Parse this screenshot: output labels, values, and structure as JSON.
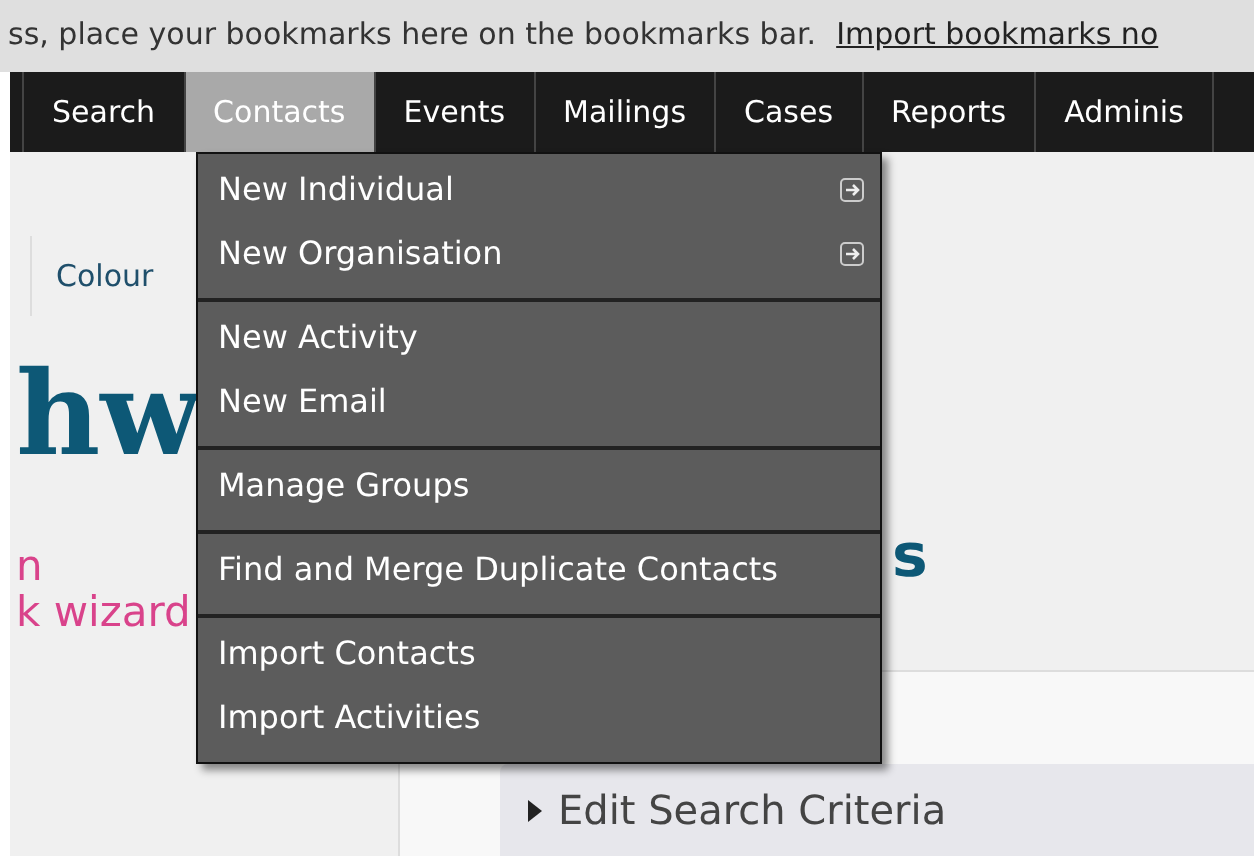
{
  "bookmarks_bar": {
    "message": "ss, place your bookmarks here on the bookmarks bar.",
    "link": "Import bookmarks no"
  },
  "nav": [
    {
      "label": "Search",
      "selected": false
    },
    {
      "label": "Contacts",
      "selected": true
    },
    {
      "label": "Events",
      "selected": false
    },
    {
      "label": "Mailings",
      "selected": false
    },
    {
      "label": "Cases",
      "selected": false
    },
    {
      "label": "Reports",
      "selected": false
    },
    {
      "label": "Adminis",
      "selected": false
    }
  ],
  "dropdown": [
    [
      {
        "label": "New Individual",
        "submenu": true
      },
      {
        "label": "New Organisation",
        "submenu": true
      }
    ],
    [
      {
        "label": "New Activity",
        "submenu": false
      },
      {
        "label": "New Email",
        "submenu": false
      }
    ],
    [
      {
        "label": "Manage Groups",
        "submenu": false
      }
    ],
    [
      {
        "label": "Find and Merge Duplicate Contacts",
        "submenu": false
      }
    ],
    [
      {
        "label": "Import Contacts",
        "submenu": false
      },
      {
        "label": "Import Activities",
        "submenu": false
      }
    ]
  ],
  "toolbar": {
    "label": "Colour"
  },
  "heading": "hw",
  "main_heading": "s",
  "sidebar_links": [
    "n",
    "k wizard"
  ],
  "search_panel": {
    "label": "Edit Search Criteria"
  }
}
